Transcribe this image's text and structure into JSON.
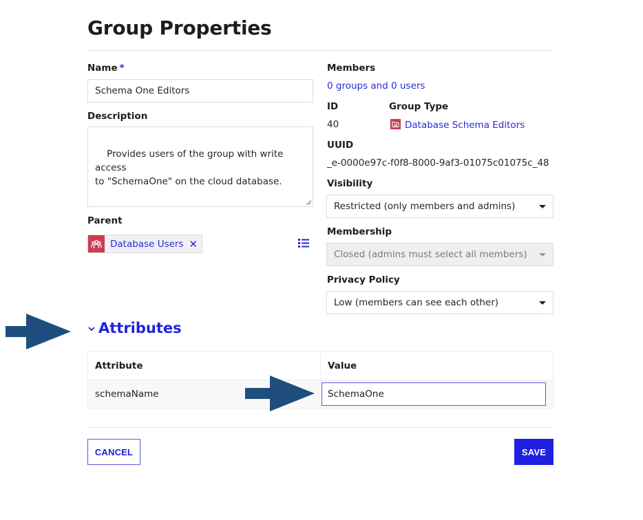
{
  "page": {
    "title": "Group Properties"
  },
  "colors": {
    "accent": "#2121e0",
    "link": "#2a2ad6",
    "icon_red": "#cc3b52",
    "annotation_arrow": "#1f4e7e"
  },
  "left": {
    "name_label": "Name",
    "name_required": "*",
    "name_value": "Schema One Editors",
    "description_label": "Description",
    "description_value": "Provides users of the group with write access\nto \"SchemaOne\" on the cloud database.",
    "parent_label": "Parent",
    "parent_chip": {
      "icon": "group-icon",
      "label": "Database Users",
      "remove_icon": "close-icon"
    },
    "parent_picker_icon": "list-icon"
  },
  "right": {
    "members_label": "Members",
    "members_value": "0 groups and 0 users",
    "id_label": "ID",
    "id_value": "40",
    "group_type_label": "Group Type",
    "group_type_value": "Database Schema Editors",
    "group_type_icon": "folder-group-icon",
    "uuid_label": "UUID",
    "uuid_value": "_e-0000e97c-f0f8-8000-9af3-01075c01075c_48",
    "visibility_label": "Visibility",
    "visibility_value": "Restricted (only members and admins)",
    "membership_label": "Membership",
    "membership_value": "Closed (admins must select all members)",
    "privacy_label": "Privacy Policy",
    "privacy_value": "Low (members can see each other)"
  },
  "attributes": {
    "heading": "Attributes",
    "chevron_icon": "chevron-down-icon",
    "columns": [
      "Attribute",
      "Value"
    ],
    "rows": [
      {
        "attribute": "schemaName",
        "value": "SchemaOne"
      }
    ]
  },
  "footer": {
    "cancel_label": "CANCEL",
    "save_label": "SAVE"
  }
}
